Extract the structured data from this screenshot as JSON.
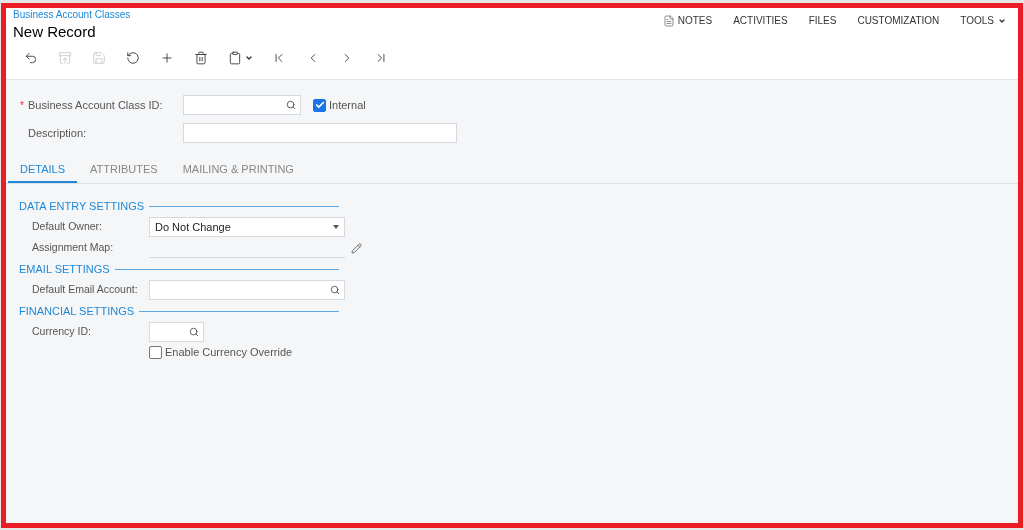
{
  "breadcrumb": "Business Account Classes",
  "title": "New Record",
  "top_menu": [
    {
      "label": "NOTES",
      "kind": "notes"
    },
    {
      "label": "ACTIVITIES",
      "kind": "plain"
    },
    {
      "label": "FILES",
      "kind": "plain"
    },
    {
      "label": "CUSTOMIZATION",
      "kind": "plain"
    },
    {
      "label": "TOOLS",
      "kind": "dropdown"
    }
  ],
  "toolbar": [
    {
      "kind": "back",
      "disabled": false
    },
    {
      "kind": "save-close",
      "disabled": true
    },
    {
      "kind": "save",
      "disabled": true
    },
    {
      "kind": "cancel",
      "disabled": false
    },
    {
      "kind": "add",
      "disabled": false
    },
    {
      "kind": "delete",
      "disabled": false
    },
    {
      "kind": "copy-paste",
      "disabled": false
    },
    {
      "kind": "first",
      "disabled": false
    },
    {
      "kind": "previous",
      "disabled": false
    },
    {
      "kind": "next",
      "disabled": false
    },
    {
      "kind": "last",
      "disabled": false
    }
  ],
  "header_fields": [
    {
      "label": "Business Account Class ID:",
      "required_mark": "*",
      "kind": "lookup",
      "checkbox": {
        "label": "Internal",
        "checked": true
      }
    },
    {
      "label": "Description:",
      "kind": "text"
    }
  ],
  "tabs": [
    {
      "label": "DETAILS",
      "selected": true
    },
    {
      "label": "ATTRIBUTES",
      "selected": false
    },
    {
      "label": "MAILING & PRINTING",
      "selected": false
    }
  ],
  "sections": [
    {
      "title": "DATA ENTRY SETTINGS",
      "fields": [
        {
          "label": "Default Owner:",
          "kind": "select",
          "value": "Do Not Change"
        },
        {
          "label": "Assignment Map:",
          "kind": "edit-lookup"
        }
      ]
    },
    {
      "title": "EMAIL SETTINGS",
      "fields": [
        {
          "label": "Default Email Account:",
          "kind": "lookup"
        }
      ]
    },
    {
      "title": "FINANCIAL SETTINGS",
      "fields": [
        {
          "label": "Currency ID:",
          "kind": "short-lookup"
        },
        {
          "label": "Enable Currency Override",
          "kind": "checkbox",
          "checked": false
        }
      ]
    }
  ]
}
